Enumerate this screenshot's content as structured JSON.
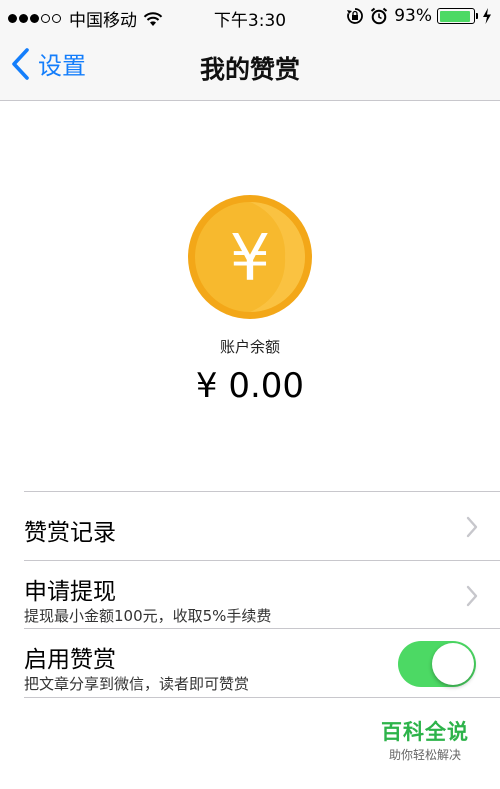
{
  "status_bar": {
    "carrier": "中国移动",
    "time": "下午3:30",
    "battery_text": "93%",
    "battery_level": 0.93
  },
  "nav": {
    "back_label": "设置",
    "title": "我的赞赏"
  },
  "balance": {
    "label": "账户余额",
    "amount": "¥ 0.00",
    "coin_symbol": "¥"
  },
  "list": {
    "items": [
      {
        "title": "赞赏记录"
      },
      {
        "title": "申请提现",
        "subtitle": "提现最小金额100元，收取5%手续费"
      },
      {
        "title": "启用赞赏",
        "subtitle": "把文章分享到微信，读者即可赞赏",
        "toggle_on": true
      }
    ]
  },
  "watermark": {
    "title": "百科全说",
    "subtitle": "助你轻松解决"
  },
  "colors": {
    "accent_blue": "#147efb",
    "toggle_green": "#4cd964",
    "coin_gold": "#f5b323"
  }
}
